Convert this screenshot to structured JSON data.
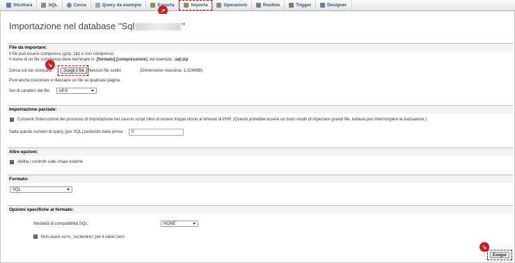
{
  "tabs": [
    {
      "label": "Struttura",
      "icon": "structure-icon",
      "color": "#5a5a5a"
    },
    {
      "label": "SQL",
      "icon": "sql-icon",
      "color": "#666666"
    },
    {
      "label": "Cerca",
      "icon": "search-icon",
      "color": "#666666"
    },
    {
      "label": "Query da esempio",
      "icon": "query-icon",
      "color": "#666666"
    },
    {
      "label": "Esporta",
      "icon": "export-icon",
      "color": "#666666"
    },
    {
      "label": "Importa",
      "icon": "import-icon",
      "color": "#666666"
    },
    {
      "label": "Operazioni",
      "icon": "wrench-icon",
      "color": "#666666"
    },
    {
      "label": "Routine",
      "icon": "routine-icon",
      "color": "#666666"
    },
    {
      "label": "Trigger",
      "icon": "trigger-icon",
      "color": "#666666"
    },
    {
      "label": "Designer",
      "icon": "designer-icon",
      "color": "#666666"
    }
  ],
  "page": {
    "title_prefix": "Importazione nel database \"Sql",
    "title_suffix": "\""
  },
  "file": {
    "header": "File da importare:",
    "line1": "Il file può essere compresso (gzip, zip) o non compresso",
    "line2_pre": "Il nome di un file compresso deve terminare in ",
    "line2_bold": ".[formato].[compressione]",
    "line2_mid": ". Ad esempio: ",
    "line2_ex": ".sql.zip",
    "browse_label": "Cerca sul tuo computer:",
    "choose_button": "Scegli il file",
    "no_file": "Nessun file scelto",
    "max_size": "(Dimensione massima: 1,024MiB)",
    "drag_hint": "Puoi anche trascinare e rilasciare un file su qualsiasi pagina",
    "charset_label": "Set di caratteri del file:",
    "charset_value": "utf-8"
  },
  "partial": {
    "header": "Importazione parziale:",
    "interrupt_label": "Consenti l'interruzione del processo di importazione nel caso lo script rilevi di essere troppo vicino al timeout di PHP.",
    "interrupt_note": "(Questo potrebbe essere un buon modo di importare grandi file, tuttavia può interrompere le transazioni.)",
    "skip_label": "Salta questo numero di query (per SQL) partendo dalla prima:",
    "skip_value": "0"
  },
  "other": {
    "header": "Altre opzioni:",
    "fk_label": "Abilita i controlli sulle chiavi esterne"
  },
  "format": {
    "header": "Formato:",
    "value": "SQL"
  },
  "format_options": {
    "header": "Opzioni specifiche al formato:",
    "compat_label": "Modalità di compatibilità SQL:",
    "compat_value": "NONE",
    "auto_label_pre": "Non usare ",
    "auto_code": "AUTO_INCREMENT",
    "auto_label_post": " per il valori zero"
  },
  "actions": {
    "go": "Esegui"
  },
  "colors": {
    "accent_red": "#cc1f1f",
    "tab_text": "#235a81"
  }
}
